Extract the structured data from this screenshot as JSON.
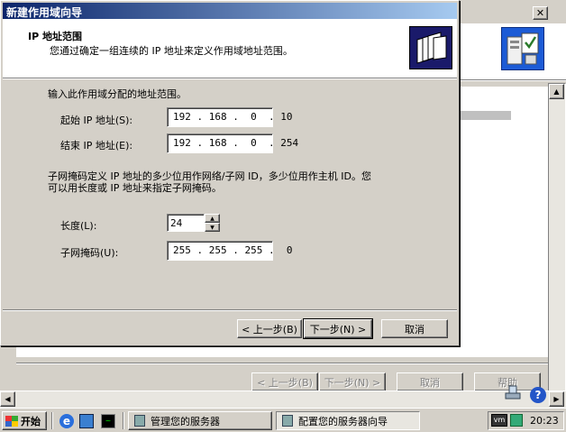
{
  "background_window": {
    "btn_back": "< 上一步(B)",
    "btn_next": "下一步(N) >",
    "btn_cancel": "取消",
    "btn_help": "帮助"
  },
  "dialog": {
    "title": "新建作用域向导",
    "header_title": "IP 地址范围",
    "header_desc": "您通过确定一组连续的 IP 地址来定义作用域地址范围。",
    "intro": "输入此作用域分配的地址范围。",
    "start_ip_label": "起始 IP 地址(S):",
    "start_ip_value": "192 . 168 .  0  . 10",
    "end_ip_label": "结束 IP 地址(E):",
    "end_ip_value": "192 . 168 .  0  . 254",
    "subnet_desc_line1": "子网掩码定义 IP 地址的多少位用作网络/子网 ID，多少位用作主机 ID。您",
    "subnet_desc_line2": "可以用长度或 IP 地址来指定子网掩码。",
    "length_label": "长度(L):",
    "length_value": "24",
    "mask_label": "子网掩码(U):",
    "mask_value": "255 . 255 . 255 .  0",
    "btn_back": "< 上一步(B)",
    "btn_next": "下一步(N) >",
    "btn_cancel": "取消"
  },
  "taskbar": {
    "start_label": "开始",
    "task1": "管理您的服务器",
    "task2": "配置您的服务器向导",
    "clock": "20:23"
  },
  "colors": {
    "titlebar_active_start": "#0a246a",
    "titlebar_active_end": "#a6caf0",
    "desktop": "#d4d0c8"
  }
}
